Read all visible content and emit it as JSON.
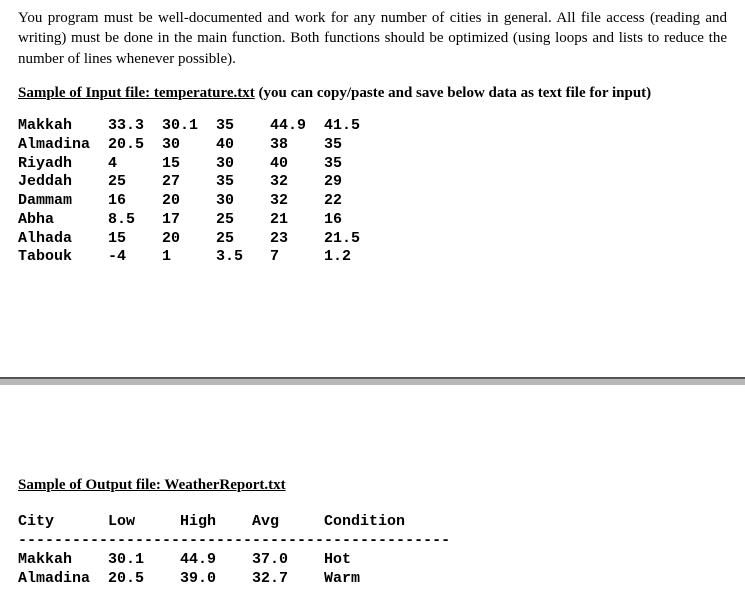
{
  "intro": "You program must be well-documented and work for any number of cities in general. All file access (reading and writing) must be done in the main function. Both functions should be optimized (using loops and lists to reduce the number of lines whenever possible).",
  "input_section": {
    "underlined": "Sample of Input file:  temperature.txt",
    "rest": " (you can copy/paste and save below data as text file for input)"
  },
  "input_rows": [
    {
      "city": "Makkah",
      "v": [
        "33.3",
        "30.1",
        "35",
        "44.9",
        "41.5"
      ]
    },
    {
      "city": "Almadina",
      "v": [
        "20.5",
        "30",
        "40",
        "38",
        "35"
      ]
    },
    {
      "city": "Riyadh",
      "v": [
        "4",
        "15",
        "30",
        "40",
        "35"
      ]
    },
    {
      "city": "Jeddah",
      "v": [
        "25",
        "27",
        "35",
        "32",
        "29"
      ]
    },
    {
      "city": "Dammam",
      "v": [
        "16",
        "20",
        "30",
        "32",
        "22"
      ]
    },
    {
      "city": "Abha",
      "v": [
        "8.5",
        "17",
        "25",
        "21",
        "16"
      ]
    },
    {
      "city": "Alhada",
      "v": [
        "15",
        "20",
        "25",
        "23",
        "21.5"
      ]
    },
    {
      "city": "Tabouk",
      "v": [
        "-4",
        "1",
        "3.5",
        "7",
        "1.2"
      ]
    }
  ],
  "output_section": {
    "underlined": "Sample of Output file:  WeatherReport.txt"
  },
  "output_header": [
    "City",
    "Low",
    "High",
    "Avg",
    "Condition"
  ],
  "output_sep": "------------------------------------------------",
  "output_rows": [
    {
      "city": "Makkah",
      "low": "30.1",
      "high": "44.9",
      "avg": "37.0",
      "cond": "Hot"
    },
    {
      "city": "Almadina",
      "low": "20.5",
      "high": "39.0",
      "avg": "32.7",
      "cond": "Warm"
    }
  ]
}
